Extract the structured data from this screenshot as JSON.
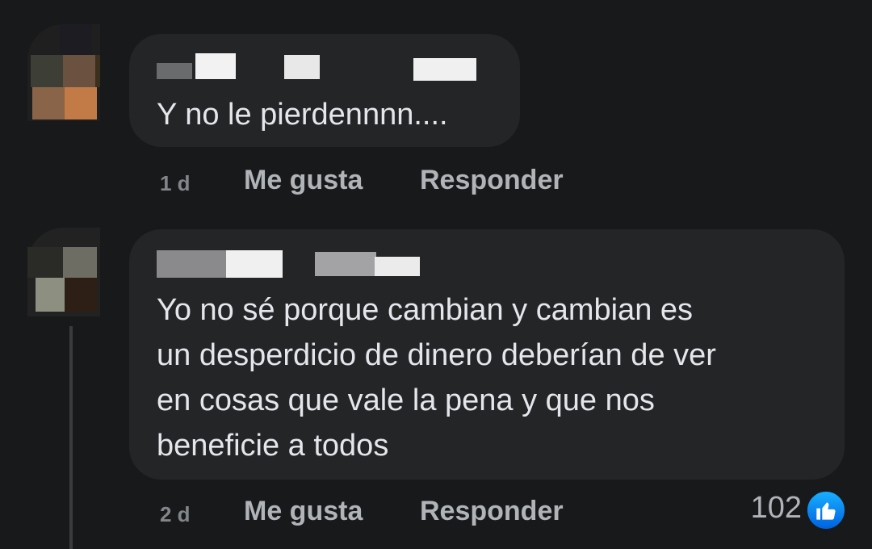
{
  "comments": [
    {
      "text": "Y no le pierdennnn....",
      "time": "1 d",
      "actions": {
        "like": "Me gusta",
        "reply": "Responder"
      }
    },
    {
      "text": "Yo no sé porque cambian y cambian es\nun desperdicio de dinero deberían de ver\nen cosas que vale la pena y que nos\nbeneficie a todos",
      "time": "2 d",
      "actions": {
        "like": "Me gusta",
        "reply": "Responder"
      },
      "reactions": {
        "count": "102",
        "icon": "thumbs-up-icon",
        "color": "#1877f2"
      }
    }
  ],
  "colors": {
    "background": "#18191a",
    "bubble": "#242526",
    "text": "#e4e6eb",
    "secondary_text": "#b0b3b8"
  }
}
